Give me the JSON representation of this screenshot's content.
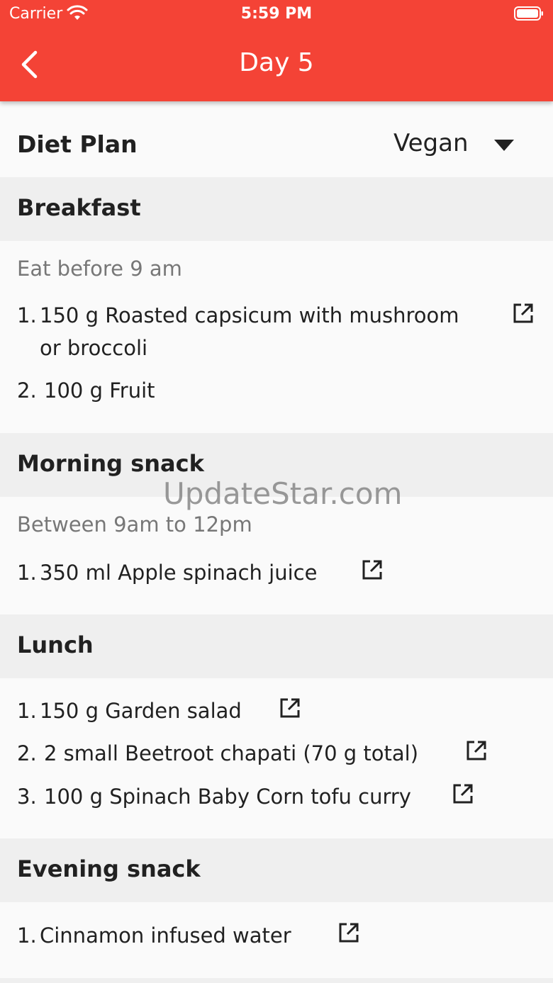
{
  "status_bar": {
    "carrier": "Carrier",
    "time": "5:59 PM"
  },
  "app_bar": {
    "title": "Day 5"
  },
  "diet_plan": {
    "label": "Diet Plan",
    "selected": "Vegan"
  },
  "sections": [
    {
      "title": "Breakfast",
      "hint": "Eat before 9 am",
      "items": [
        {
          "num": "1.",
          "text": "150 g Roasted capsicum with mushroom"
        },
        {
          "num": "",
          "text": "or broccoli"
        },
        {
          "num": "2.",
          "text": "100 g Fruit"
        }
      ]
    },
    {
      "title": "Morning snack",
      "hint": "Between 9am to 12pm",
      "items": [
        {
          "num": "1.",
          "text": "350 ml Apple spinach juice"
        }
      ]
    },
    {
      "title": "Lunch",
      "items": [
        {
          "num": "1.",
          "text": "150 g Garden salad"
        },
        {
          "num": "2.",
          "text": "2 small Beetroot chapati (70 g total)"
        },
        {
          "num": "3.",
          "text": "100 g Spinach Baby Corn tofu curry"
        }
      ]
    },
    {
      "title": "Evening snack",
      "items": [
        {
          "num": "1.",
          "text": "Cinnamon infused water"
        }
      ]
    }
  ],
  "watermark": "UpdateStar.com",
  "colors": {
    "accent": "#f44336",
    "header_bg": "#efefef",
    "page_bg": "#fafafa"
  },
  "icons": [
    "wifi-icon",
    "battery-icon",
    "back-arrow-icon",
    "dropdown-caret-icon",
    "open-in-new-icon"
  ]
}
